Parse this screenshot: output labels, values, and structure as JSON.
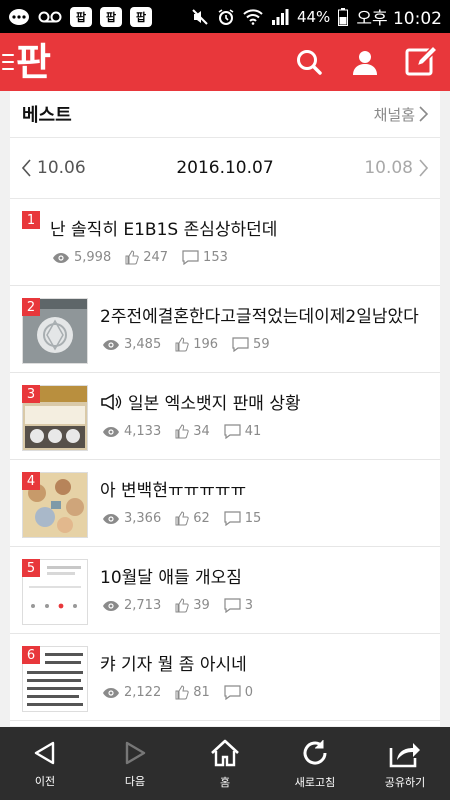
{
  "status_bar": {
    "apps": [
      "팝",
      "팝",
      "팝"
    ],
    "battery": "44%",
    "time": "오후 10:02"
  },
  "header": {
    "logo": "판"
  },
  "section": {
    "title": "베스트",
    "channel_link": "채널홈"
  },
  "date_nav": {
    "prev": "10.06",
    "current": "2016.10.07",
    "next": "10.08"
  },
  "posts": [
    {
      "rank": "1",
      "title": "난 솔직히 E1B1S 존심상하던데",
      "views": "5,998",
      "likes": "247",
      "comments": "153",
      "has_thumb": false
    },
    {
      "rank": "2",
      "title": "2주전에결혼한다고글적었는데이제2일남았다",
      "views": "3,485",
      "likes": "196",
      "comments": "59",
      "has_thumb": true
    },
    {
      "rank": "3",
      "title": "일본 엑소뱃지 판매 상황",
      "views": "4,133",
      "likes": "34",
      "comments": "41",
      "has_thumb": true
    },
    {
      "rank": "4",
      "title": "아 변백현ㅠㅠㅠㅠㅠ",
      "views": "3,366",
      "likes": "62",
      "comments": "15",
      "has_thumb": true
    },
    {
      "rank": "5",
      "title": "10월달 애들 개오짐",
      "views": "2,713",
      "likes": "39",
      "comments": "3",
      "has_thumb": true
    },
    {
      "rank": "6",
      "title": "캬 기자 뭘 좀 아시네",
      "views": "2,122",
      "likes": "81",
      "comments": "0",
      "has_thumb": true
    }
  ],
  "bottom_nav": [
    {
      "label": "이전"
    },
    {
      "label": "다음"
    },
    {
      "label": "홈"
    },
    {
      "label": "새로고침"
    },
    {
      "label": "공유하기"
    }
  ],
  "colors": {
    "brand_red": "#e8373b",
    "bottom_bar": "#2d2d2d"
  }
}
